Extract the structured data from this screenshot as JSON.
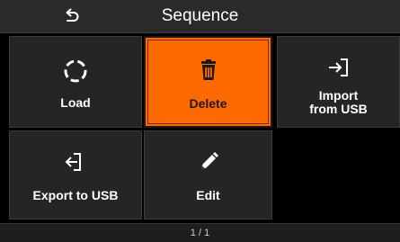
{
  "header": {
    "title": "Sequence",
    "back_icon": "back-arrow-icon"
  },
  "tiles": [
    {
      "label": "Load",
      "icon": "load-circle-icon",
      "active": false
    },
    {
      "label": "Delete",
      "icon": "trash-icon",
      "active": true
    },
    {
      "label_line1": "Import",
      "label_line2": "from USB",
      "icon": "import-icon",
      "active": false
    },
    {
      "label": "Export to USB",
      "icon": "export-icon",
      "active": false
    },
    {
      "label": "Edit",
      "icon": "pencil-icon",
      "active": false
    }
  ],
  "footer": {
    "page_indicator": "1 / 1"
  },
  "colors": {
    "accent": "#ff6a00",
    "tile_bg": "#252525",
    "header_bg": "#2a2a2a",
    "background": "#000000"
  }
}
